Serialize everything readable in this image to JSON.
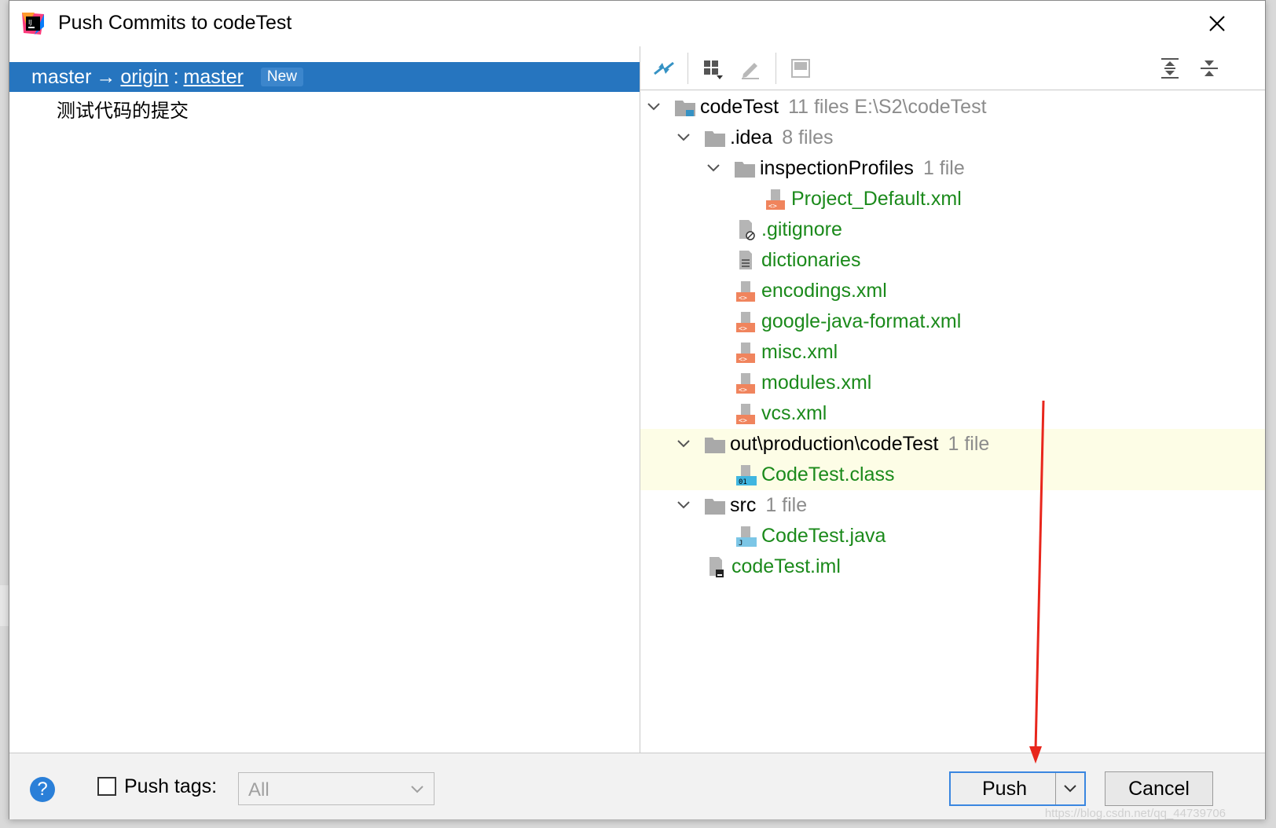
{
  "window": {
    "title": "Push Commits to codeTest"
  },
  "branch": {
    "local": "master",
    "arrow": "→",
    "remote": "origin",
    "separator": ":",
    "remote_branch": "master",
    "badge": "New"
  },
  "commits": [
    {
      "message": "测试代码的提交"
    }
  ],
  "toolbar": {
    "icons": [
      "merge-arrows-icon",
      "group-by-icon",
      "edit-icon",
      "preview-icon",
      "expand-all-icon",
      "collapse-all-icon"
    ]
  },
  "tree": [
    {
      "label": "codeTest",
      "extra": "11 files  E:\\S2\\codeTest",
      "kind": "dir"
    },
    {
      "label": ".idea",
      "extra": "8 files",
      "kind": "dir"
    },
    {
      "label": "inspectionProfiles",
      "extra": "1 file",
      "kind": "dir"
    },
    {
      "label": "Project_Default.xml",
      "extra": "",
      "kind": "file"
    },
    {
      "label": ".gitignore",
      "extra": "",
      "kind": "file"
    },
    {
      "label": "dictionaries",
      "extra": "",
      "kind": "file"
    },
    {
      "label": "encodings.xml",
      "extra": "",
      "kind": "file"
    },
    {
      "label": "google-java-format.xml",
      "extra": "",
      "kind": "file"
    },
    {
      "label": "misc.xml",
      "extra": "",
      "kind": "file"
    },
    {
      "label": "modules.xml",
      "extra": "",
      "kind": "file"
    },
    {
      "label": "vcs.xml",
      "extra": "",
      "kind": "file"
    },
    {
      "label": "out\\production\\codeTest",
      "extra": "1 file",
      "kind": "dir"
    },
    {
      "label": "CodeTest.class",
      "extra": "",
      "kind": "file"
    },
    {
      "label": "src",
      "extra": "1 file",
      "kind": "dir"
    },
    {
      "label": "CodeTest.java",
      "extra": "",
      "kind": "file"
    },
    {
      "label": "codeTest.iml",
      "extra": "",
      "kind": "file"
    }
  ],
  "footer": {
    "help": "?",
    "push_tags_label": "Push tags:",
    "tags_select_value": "All",
    "push_label": "Push",
    "cancel_label": "Cancel"
  },
  "watermark": "https://blog.csdn.net/qq_44739706",
  "colors": {
    "selection": "#2675bf",
    "file_label": "#1b8a1b",
    "highlight_row": "#fdfde6",
    "annotation_arrow": "#e8261c"
  }
}
